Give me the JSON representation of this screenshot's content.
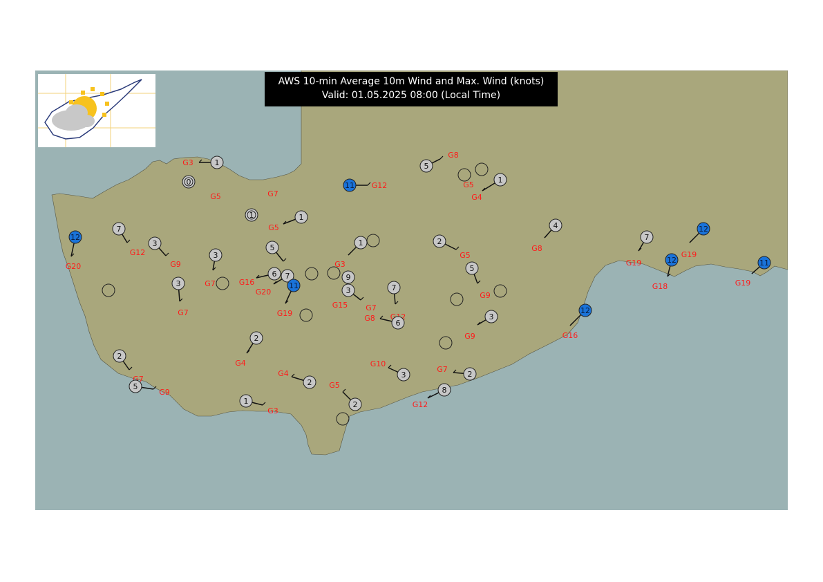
{
  "map": {
    "title_line1": "AWS 10-min Average 10m Wind and Max. Wind (knots)",
    "title_line2": "Valid: 01.05.2025 08:00 (Local Time)",
    "colors": {
      "sea": "#9bb3b4",
      "land": "#a9a77c",
      "station_fill": "#c7c7c7",
      "station_strong_fill": "#1a73d9",
      "gust_text": "#ff1a1a",
      "title_bg": "#000000",
      "sun": "#f7c21e",
      "cloud": "#c8c8c8"
    },
    "logo_icon": "sun-cloud-cyprus-logo-icon"
  },
  "stations": [
    {
      "speed": "1",
      "gust": "G3"
    },
    {
      "speed": "0",
      "gust": ""
    },
    {
      "speed": "",
      "gust": "G5"
    },
    {
      "speed": "",
      "gust": "G7"
    },
    {
      "speed": "1",
      "gust": ""
    },
    {
      "speed": "1",
      "gust": "G5"
    },
    {
      "speed": "11",
      "gust": "G12",
      "strong": true
    },
    {
      "speed": "5",
      "gust": "G8"
    },
    {
      "speed": "",
      "gust": ""
    },
    {
      "speed": "",
      "gust": ""
    },
    {
      "speed": "1",
      "gust": "G5"
    },
    {
      "speed": "",
      "gust": "G4"
    },
    {
      "speed": "12",
      "gust": "G20",
      "strong": true
    },
    {
      "speed": "7",
      "gust": "G12"
    },
    {
      "speed": "3",
      "gust": "G9"
    },
    {
      "speed": "3",
      "gust": "G7"
    },
    {
      "speed": "",
      "gust": ""
    },
    {
      "speed": "3",
      "gust": "G7"
    },
    {
      "speed": "",
      "gust": ""
    },
    {
      "speed": "5",
      "gust": ""
    },
    {
      "speed": "6",
      "gust": "G16"
    },
    {
      "speed": "7",
      "gust": "G20"
    },
    {
      "speed": "11",
      "gust": "G19",
      "strong": true
    },
    {
      "speed": "1",
      "gust": "G3"
    },
    {
      "speed": "",
      "gust": ""
    },
    {
      "speed": "",
      "gust": ""
    },
    {
      "speed": "",
      "gust": ""
    },
    {
      "speed": "9",
      "gust": ""
    },
    {
      "speed": "3",
      "gust": "G15"
    },
    {
      "speed": "",
      "gust": "G7"
    },
    {
      "speed": "7",
      "gust": "G12"
    },
    {
      "speed": "6",
      "gust": "G8"
    },
    {
      "speed": "2",
      "gust": "G5"
    },
    {
      "speed": "5",
      "gust": "G9"
    },
    {
      "speed": "",
      "gust": ""
    },
    {
      "speed": "",
      "gust": ""
    },
    {
      "speed": "4",
      "gust": "G8"
    },
    {
      "speed": "3",
      "gust": "G9"
    },
    {
      "speed": "",
      "gust": ""
    },
    {
      "speed": "",
      "gust": ""
    },
    {
      "speed": "2",
      "gust": "G4"
    },
    {
      "speed": "2",
      "gust": "G7"
    },
    {
      "speed": "5",
      "gust": "G9"
    },
    {
      "speed": "2",
      "gust": "G4"
    },
    {
      "speed": "1",
      "gust": "G3"
    },
    {
      "speed": "2",
      "gust": "G5"
    },
    {
      "speed": "",
      "gust": ""
    },
    {
      "speed": "3",
      "gust": "G10"
    },
    {
      "speed": "2",
      "gust": "G7"
    },
    {
      "speed": "8",
      "gust": "G12"
    },
    {
      "speed": "12",
      "gust": "G16",
      "strong": true
    },
    {
      "speed": "7",
      "gust": "G19"
    },
    {
      "speed": "12",
      "gust": "G19",
      "strong": true
    },
    {
      "speed": "12",
      "gust": "G18",
      "strong": true
    },
    {
      "speed": "11",
      "gust": "G19",
      "strong": true
    }
  ]
}
